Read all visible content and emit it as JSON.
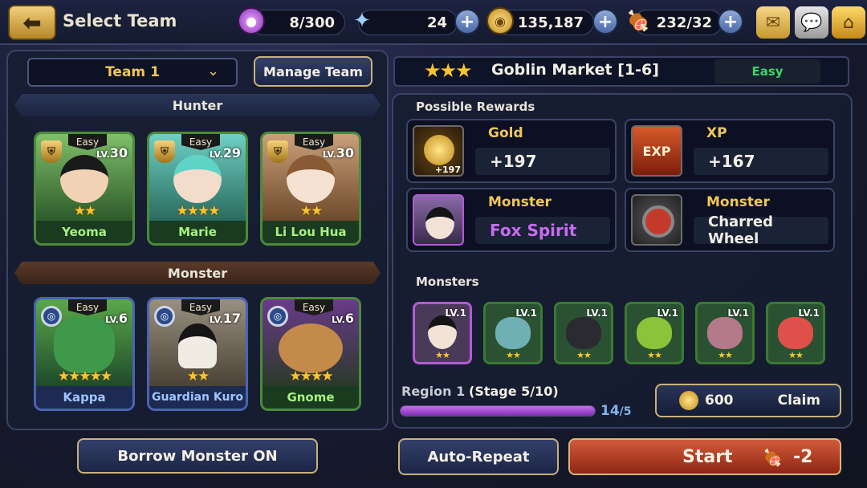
{
  "header": {
    "title": "Select Team",
    "energy": "8/300",
    "gems": "24",
    "gold": "135,187",
    "meat": "232/32"
  },
  "team": {
    "selected": "Team 1",
    "manage_label": "Manage Team",
    "hunter_section": "Hunter",
    "monster_section": "Monster",
    "hunters": [
      {
        "name": "Yeoma",
        "level": "30",
        "difficulty": "Easy",
        "stars": "★★"
      },
      {
        "name": "Marie",
        "level": "29",
        "difficulty": "Easy",
        "stars": "★★★★"
      },
      {
        "name": "Li Lou Hua",
        "level": "30",
        "difficulty": "Easy",
        "stars": "★★"
      }
    ],
    "monsters": [
      {
        "name": "Kappa",
        "level": "6",
        "difficulty": "Easy",
        "stars": "★★★★★"
      },
      {
        "name": "Guardian Kuro",
        "level": "17",
        "difficulty": "Easy",
        "stars": "★★"
      },
      {
        "name": "Gnome",
        "level": "6",
        "difficulty": "Easy",
        "stars": "★★★★"
      }
    ],
    "borrow_label": "Borrow Monster ON"
  },
  "stage": {
    "stars": "★★★",
    "title": "Goblin Market [1-6]",
    "difficulty": "Easy",
    "rewards_heading": "Possible Rewards",
    "rewards": [
      {
        "label": "Gold",
        "value": "+197",
        "icon_caption": "+197"
      },
      {
        "label": "XP",
        "value": "+167",
        "icon_caption": "EXP"
      },
      {
        "label": "Monster",
        "value": "Fox Spirit"
      },
      {
        "label": "Monster",
        "value": "Charred Wheel"
      }
    ],
    "monsters_heading": "Monsters",
    "enemy_monsters": [
      {
        "level": "LV.1",
        "stars": "★★"
      },
      {
        "level": "LV.1",
        "stars": "★★"
      },
      {
        "level": "LV.1",
        "stars": "★★"
      },
      {
        "level": "LV.1",
        "stars": "★★"
      },
      {
        "level": "LV.1",
        "stars": "★★"
      },
      {
        "level": "LV.1",
        "stars": "★★"
      }
    ],
    "region": "Region 1",
    "stage_progress": "(Stage 5/10)",
    "progress_current": "14",
    "progress_total": "/5",
    "progress_fraction": 1.0,
    "claim_amount": "600",
    "claim_label": "Claim",
    "auto_repeat_label": "Auto-Repeat",
    "start_label": "Start",
    "start_cost": "-2"
  },
  "colors": {
    "accent_gold": "#f0c65b",
    "easy_green": "#3ed463",
    "start_red": "#c4482a",
    "fox_purple": "#c86cf0"
  }
}
